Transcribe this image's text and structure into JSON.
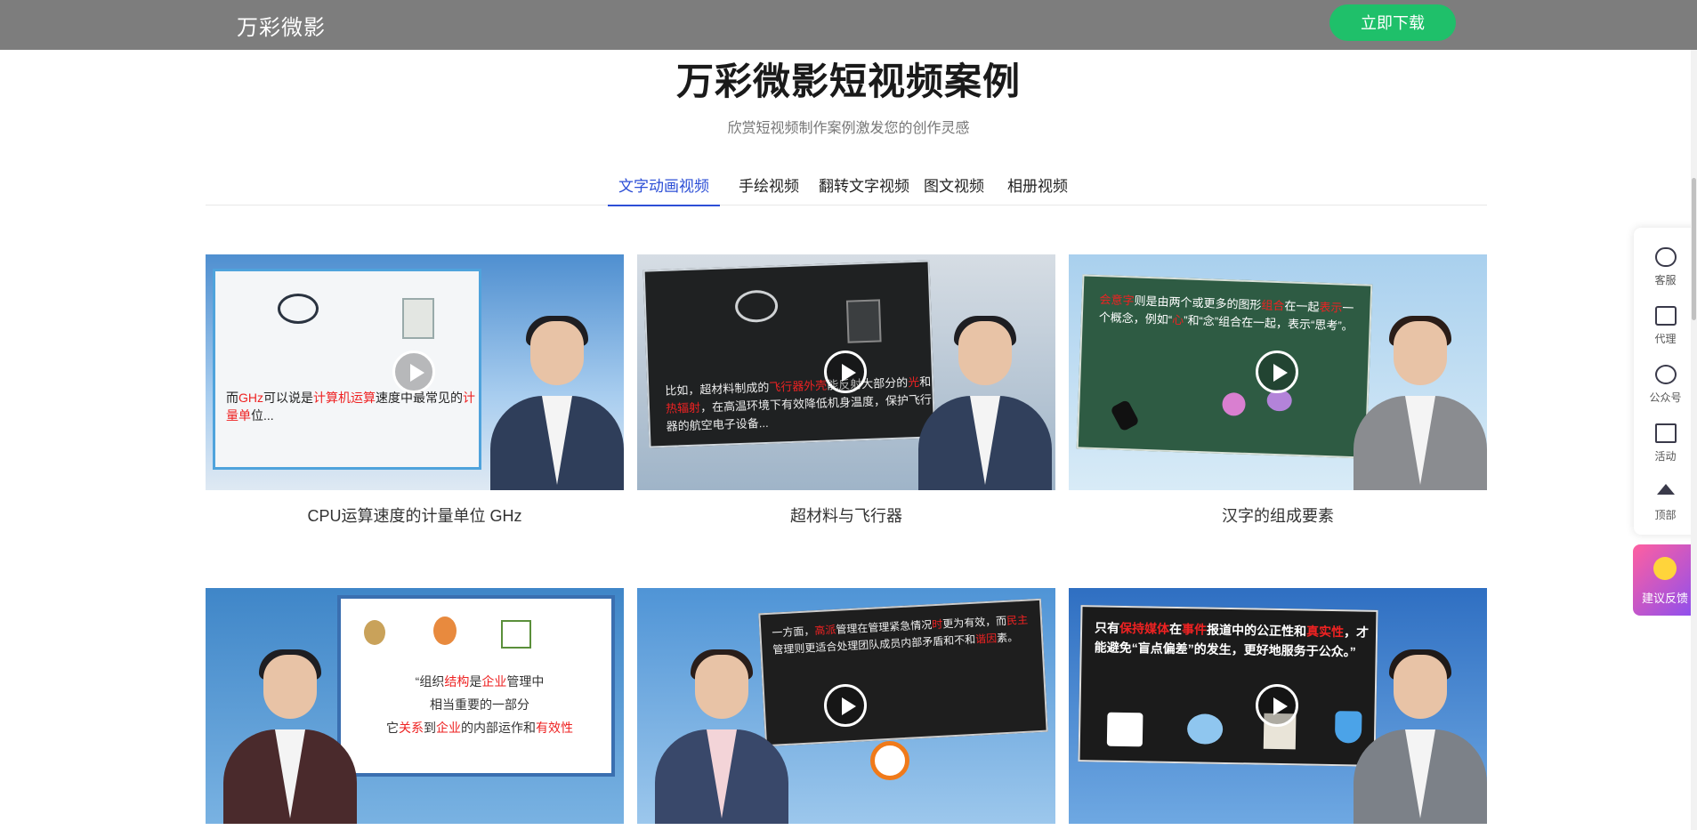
{
  "header": {
    "brand": "万彩微影",
    "download_label": "立即下载"
  },
  "page": {
    "title": "万彩微影短视频案例",
    "subtitle": "欣赏短视频制作案例激发您的创作灵感"
  },
  "tabs": [
    {
      "label": "文字动画视频",
      "active": true
    },
    {
      "label": "手绘视频",
      "active": false
    },
    {
      "label": "翻转文字视频",
      "active": false
    },
    {
      "label": "图文视频",
      "active": false
    },
    {
      "label": "相册视频",
      "active": false
    }
  ],
  "cards": [
    {
      "title": "CPU运算速度的计量单位 GHz",
      "screen_text": {
        "p1": "而",
        "h1": "GHz",
        "p2": "可以说是",
        "h2": "计算机运算",
        "p3": "速度中最常见的",
        "h3": "计量单",
        "p4": "位..."
      }
    },
    {
      "title": "超材料与飞行器",
      "screen_text": {
        "p1": "比如，超材料制成的",
        "h1": "飞行器外壳",
        "p2": "能反射大部分的",
        "h2": "光",
        "p3": "和",
        "h3": "热辐射",
        "p4": "，在高温环境下有效降低机身温度，保护飞行器的航空电子设备..."
      }
    },
    {
      "title": "汉字的组成要素",
      "screen_text": {
        "h1": "会意字",
        "p1": "则是由两个或更多的图形",
        "h2": "组合",
        "p2": "在一起",
        "h3": "表示",
        "p3": "一个概念，例如“",
        "h4": "心",
        "p4": "”和“念”组合在一起，表示“思考”。"
      }
    },
    {
      "title": "",
      "screen_text": {
        "p1": "“组织",
        "h1": "结构",
        "p2": "是",
        "h2": "企业",
        "p3": "管理中",
        "line2": "相当重要的一部分",
        "p4": "它",
        "h3": "关系",
        "p5": "到",
        "h4": "企业",
        "p6": "的内部运作和",
        "h5": "有效性"
      }
    },
    {
      "title": "",
      "screen_text": {
        "p1": "一方面，",
        "h1": "高派",
        "p2": "管理在管理紧急情况",
        "h2": "时",
        "p3": "更为有效，而",
        "h3": "民主",
        "p4": "管理则更适合处理团队成员内部矛盾和不和",
        "h4": "谐因",
        "p5": "素。"
      }
    },
    {
      "title": "",
      "screen_text": {
        "p1": "只有",
        "h1": "保持媒体",
        "p2": "在",
        "h2": "事件",
        "p3": "报道中的公正性和",
        "h3": "真实性",
        "p4": "，才能避免“盲点偏差”的发生，更好地服务于公众。”"
      }
    }
  ],
  "sidebar": {
    "items": [
      {
        "label": "客服",
        "icon": "headset-icon"
      },
      {
        "label": "代理",
        "icon": "briefcase-icon"
      },
      {
        "label": "公众号",
        "icon": "wechat-icon"
      },
      {
        "label": "活动",
        "icon": "gift-icon"
      },
      {
        "label": "顶部",
        "icon": "back-to-top-icon"
      }
    ],
    "feedback_label": "建议反馈"
  },
  "colors": {
    "topbar": "#7d7d7d",
    "download_button": "#1fc06a",
    "tab_active": "#2d4fd6",
    "highlight_text": "#ee2222"
  }
}
